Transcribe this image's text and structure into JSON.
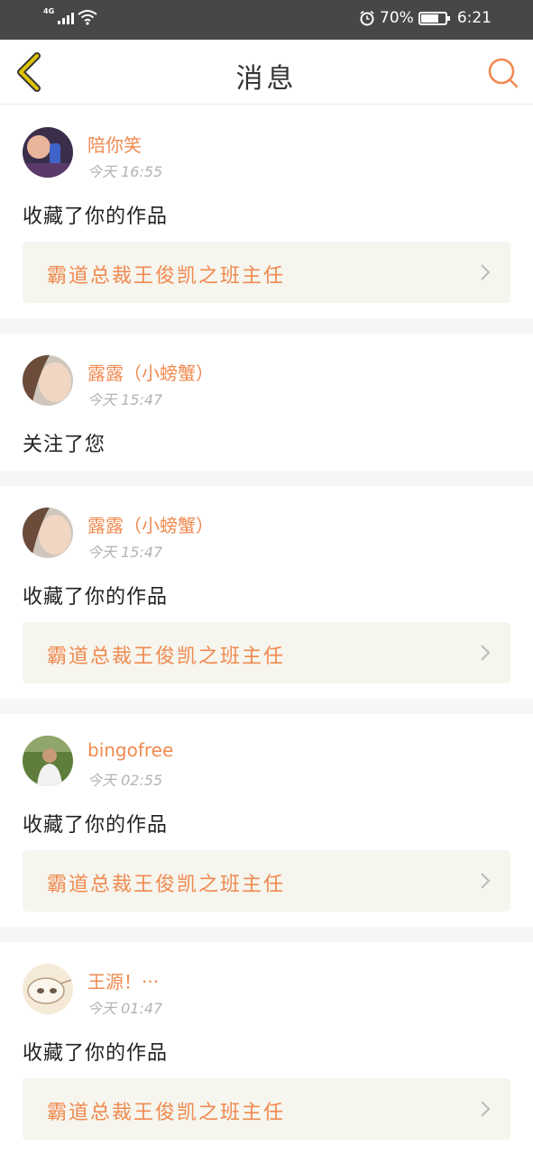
{
  "status_bar": {
    "network": "4G",
    "battery_percent": "70%",
    "battery_level": 0.7,
    "time": "6:21",
    "icons": [
      "signal-icon",
      "wifi-icon",
      "alarm-icon",
      "battery-icon"
    ]
  },
  "nav": {
    "title": "消息",
    "back_icon": "chevron-left-icon",
    "search_icon": "search-icon"
  },
  "colors": {
    "accent": "#f08a50",
    "back_icon": "#e0c400",
    "status_bar_bg": "#474747",
    "link_bg": "#f6f5ee"
  },
  "messages": [
    {
      "username": "陪你笑",
      "time": "今天 16:55",
      "action": "收藏了你的作品",
      "work_title": "霸道总裁王俊凯之班主任"
    },
    {
      "username": "露露（小螃蟹）",
      "time": "今天 15:47",
      "action": "关注了您",
      "work_title": ""
    },
    {
      "username": "露露（小螃蟹）",
      "time": "今天 15:47",
      "action": "收藏了你的作品",
      "work_title": "霸道总裁王俊凯之班主任"
    },
    {
      "username": "bingofree",
      "time": "今天 02:55",
      "action": "收藏了你的作品",
      "work_title": "霸道总裁王俊凯之班主任"
    },
    {
      "username": "王源！···",
      "time": "今天 01:47",
      "action": "收藏了你的作品",
      "work_title": "霸道总裁王俊凯之班主任"
    }
  ]
}
